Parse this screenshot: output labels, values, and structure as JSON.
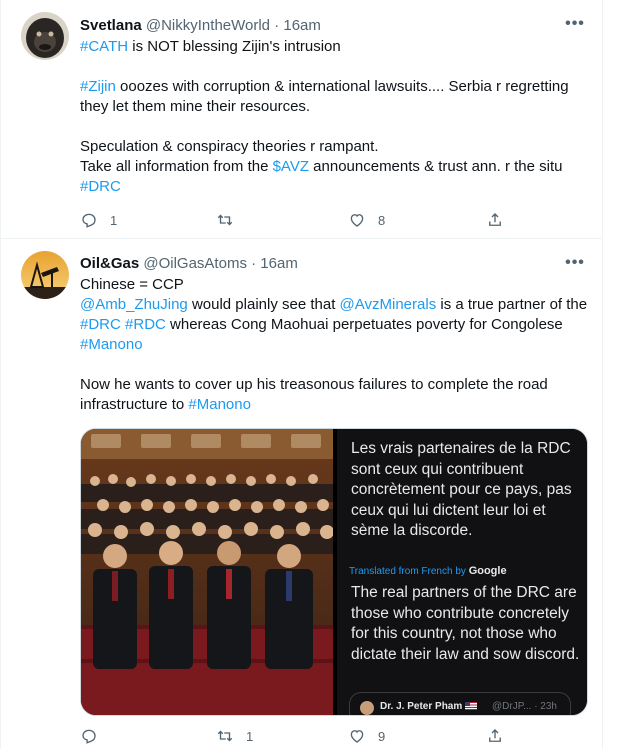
{
  "tweets": [
    {
      "name": "Svetlana",
      "handle": "@NikkyIntheWorld",
      "separator": "·",
      "time": "16am",
      "more": "•••",
      "line1": {
        "t1": "#CATH",
        "t2": " is NOT blessing Zijin's intrusion"
      },
      "line2": {
        "t1": "#Zijin",
        "t2": " ooozes with corruption & international lawsuits.... Serbia r regretting"
      },
      "line3": "they let them mine their resources.",
      "line4": "Speculation & conspiracy theories r rampant.",
      "line5": {
        "t1": "Take all information from the ",
        "t2": "$AVZ",
        "t3": " announcements & trust ann. r the situ"
      },
      "line6": "#DRC",
      "actions": {
        "replies": "1",
        "retweets": "",
        "likes": "8"
      }
    },
    {
      "name": "Oil&Gas",
      "handle": "@OilGasAtoms",
      "separator": "·",
      "time": "16am",
      "more": "•••",
      "line1": "Chinese = CCP",
      "line2": {
        "t1": "@Amb_ZhuJing",
        "t2": " would plainly see that ",
        "t3": "@AvzMinerals",
        "t4": " is a true partner of the"
      },
      "line3": {
        "t1": "#DRC",
        "t2": " ",
        "t3": "#RDC",
        "t4": " whereas Cong Maohuai perpetuates poverty for Congolese"
      },
      "line4": "#Manono",
      "line5": "Now he wants to cover up his treasonous failures to complete the road",
      "line6": {
        "t1": "infrastructure to ",
        "t2": "#Manono"
      },
      "media": {
        "french": "Les vrais partenaires de la RDC sont ceux qui contribuent concrètement pour ce pays, pas ceux qui lui dictent leur loi et sème la discorde.",
        "translated_label": "Translated from French by",
        "translated_brand": "Google",
        "english": "The real partners of the DRC are those who contribute concretely for this country, not those who dictate their law and sow discord.",
        "quote_name": "Dr. J. Peter Pham",
        "quote_handle": "@DrJP... · 23h"
      },
      "actions": {
        "replies": "",
        "retweets": "1",
        "likes": "9"
      }
    }
  ],
  "colors": {
    "link": "#1d9bf0",
    "text": "#0f1419",
    "muted": "#536471",
    "border": "#eff3f4"
  },
  "icons": [
    "reply-icon",
    "retweet-icon",
    "like-icon",
    "share-icon",
    "more-icon"
  ]
}
